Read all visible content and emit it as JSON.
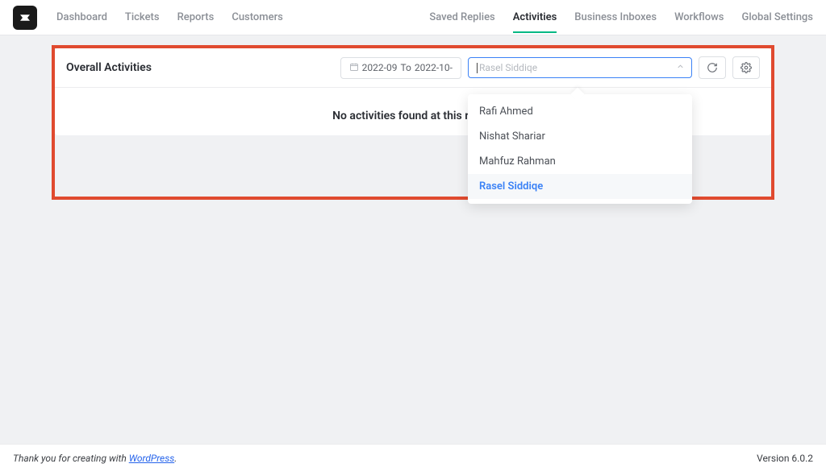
{
  "nav": {
    "left": [
      "Dashboard",
      "Tickets",
      "Reports",
      "Customers"
    ],
    "right": [
      "Saved Replies",
      "Activities",
      "Business Inboxes",
      "Workflows",
      "Global Settings"
    ],
    "active": "Activities"
  },
  "panel": {
    "title": "Overall Activities",
    "date_from": "2022-09",
    "date_mid": "To",
    "date_to": "2022-10-",
    "select_placeholder": "Rasel Siddiqe",
    "empty_message": "No activities found at this range",
    "dropdown_options": [
      "Rafi Ahmed",
      "Nishat Shariar",
      "Mahfuz Rahman",
      "Rasel Siddiqe"
    ],
    "dropdown_selected": "Rasel Siddiqe"
  },
  "footer": {
    "prefix": "Thank you for creating with ",
    "link_text": "WordPress",
    "suffix": ".",
    "version": "Version 6.0.2"
  }
}
